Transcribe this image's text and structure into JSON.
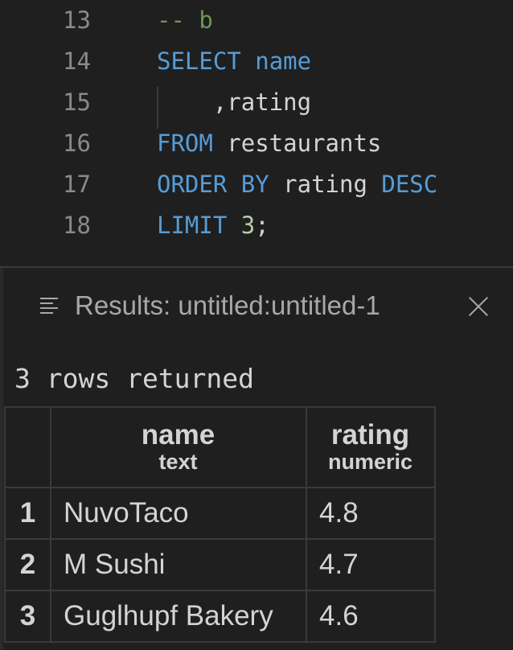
{
  "editor": {
    "lines": [
      {
        "number": "13",
        "tokens": [
          {
            "t": "-- b",
            "c": "cm"
          }
        ]
      },
      {
        "number": "14",
        "tokens": [
          {
            "t": "SELECT",
            "c": "kw"
          },
          {
            "t": " "
          },
          {
            "t": "name",
            "c": "kw"
          }
        ]
      },
      {
        "number": "15",
        "tokens": [
          {
            "t": "    ,rating"
          }
        ]
      },
      {
        "number": "16",
        "tokens": [
          {
            "t": "FROM",
            "c": "kw"
          },
          {
            "t": " restaurants"
          }
        ]
      },
      {
        "number": "17",
        "tokens": [
          {
            "t": "ORDER BY",
            "c": "kw"
          },
          {
            "t": " rating "
          },
          {
            "t": "DESC",
            "c": "kw"
          }
        ]
      },
      {
        "number": "18",
        "tokens": [
          {
            "t": "LIMIT",
            "c": "kw"
          },
          {
            "t": " "
          },
          {
            "t": "3",
            "c": "num"
          },
          {
            "t": ";"
          }
        ]
      }
    ]
  },
  "results": {
    "title": "Results: untitled:untitled-1",
    "row_count": "3 rows returned",
    "columns": [
      {
        "name": "name",
        "type": "text"
      },
      {
        "name": "rating",
        "type": "numeric"
      }
    ],
    "rows": [
      {
        "index": "1",
        "name": "NuvoTaco",
        "rating": "4.8"
      },
      {
        "index": "2",
        "name": "M Sushi",
        "rating": "4.7"
      },
      {
        "index": "3",
        "name": "Guglhupf Bakery",
        "rating": "4.6"
      }
    ]
  },
  "colors": {
    "background": "#1f1f1f",
    "keyword": "#569cd6",
    "comment": "#6a9955",
    "number": "#b5cea8",
    "text": "#d4d4d4"
  }
}
